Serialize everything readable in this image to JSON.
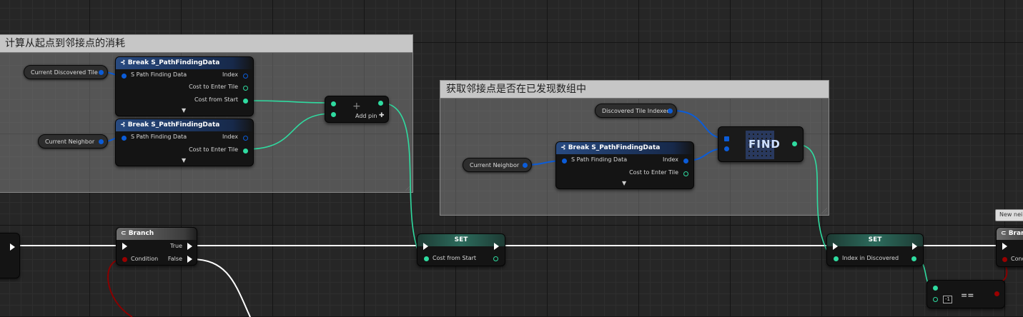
{
  "comments": {
    "c1_title": "计算从起点到邻接点的消耗",
    "c2_title": "获取邻接点是否在已发现数组中"
  },
  "vars": {
    "current_discovered_tile": "Current Discovered Tile",
    "current_neighbor": "Current Neighbor",
    "discovered_tile_indexed": "Discovered Tile Indexed"
  },
  "break": {
    "title": "Break S_PathFindingData",
    "in": "S Path Finding Data",
    "index": "Index",
    "cost_enter": "Cost to Enter Tile",
    "cost_start": "Cost from Start",
    "expand": "▼"
  },
  "add": {
    "plus": "+",
    "add_pin": "Add pin",
    "add_pin_icon": "✚"
  },
  "find": {
    "label": "FIND"
  },
  "branch": {
    "title": "Branch",
    "condition": "Condition",
    "true": "True",
    "false": "False",
    "cut_title": "Bran",
    "cut_cond": "Cond"
  },
  "set1": {
    "title": "SET",
    "pin": "Cost from Start"
  },
  "set2": {
    "title": "SET",
    "pin": "Index in Discovered"
  },
  "equal": {
    "op": "==",
    "literal": "-1"
  },
  "tooltip": {
    "text": "New nei"
  },
  "colors": {
    "exec": "#ffffff",
    "struct": "#0b5cd8",
    "float": "#2fdba0",
    "bool": "#9a0000"
  },
  "icons": {
    "branch": "branch-icon",
    "break": "break-struct-icon"
  }
}
